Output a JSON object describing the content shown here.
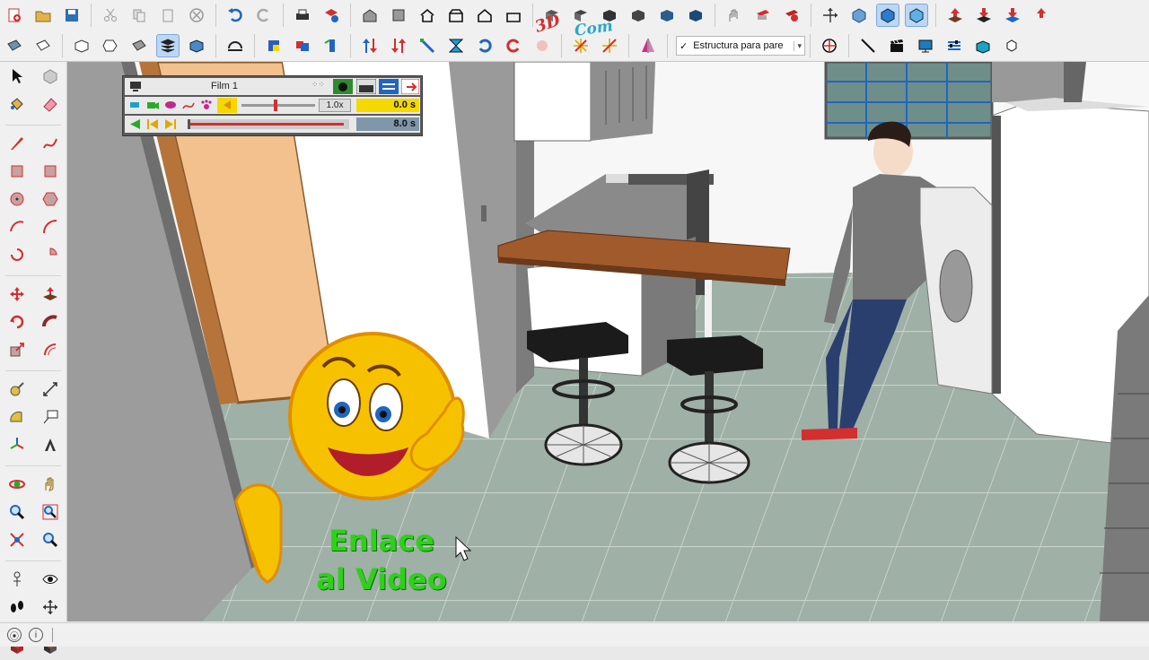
{
  "toolbar": {
    "style_selector": {
      "checked": "✓",
      "value": "Estructura para pare"
    },
    "watermark": {
      "part1": "3D",
      "part2": "Com"
    }
  },
  "animation": {
    "title": "Film 1",
    "speed": "1.0x",
    "current_time": "0.0 s",
    "total_time": "8.0 s",
    "progress": 0.0
  },
  "overlay": {
    "link_line1": "Enlace",
    "link_line2": "al Video"
  },
  "colors": {
    "accent_red": "#d32f2f",
    "link_green": "#2fd01a",
    "time_yellow": "#f5d800",
    "floor": "#9fb0a6"
  }
}
